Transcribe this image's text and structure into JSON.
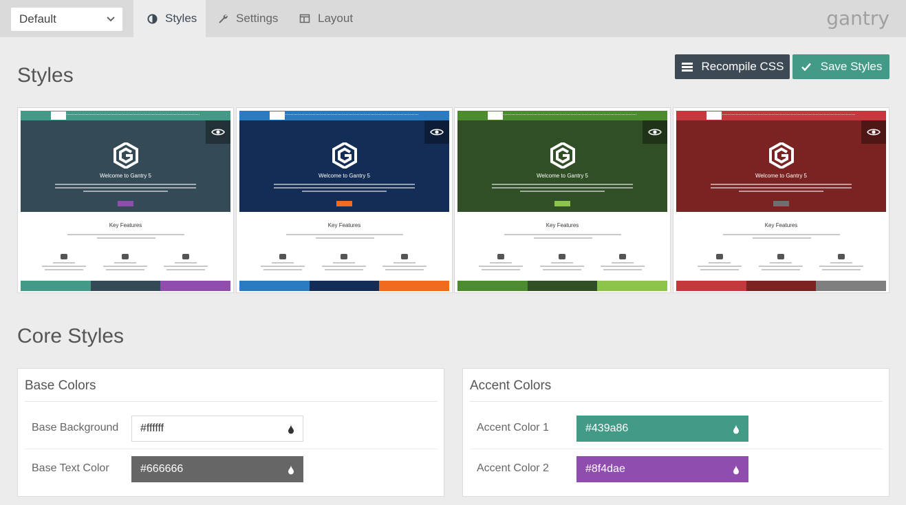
{
  "topbar": {
    "preset_select": "Default",
    "tabs": [
      {
        "label": "Styles",
        "icon": "contrast-icon",
        "active": true
      },
      {
        "label": "Settings",
        "icon": "wrench-icon",
        "active": false
      },
      {
        "label": "Layout",
        "icon": "layout-icon",
        "active": false
      }
    ],
    "logo": "gantry"
  },
  "styles_section": {
    "title": "Styles",
    "recompile_label": "Recompile CSS",
    "save_label": "Save Styles"
  },
  "presets": [
    {
      "nav_color": "#439a86",
      "hero_color": "#354a57",
      "button_color": "#8f4dae",
      "swatches": [
        "#439a86",
        "#354a57",
        "#8f4dae"
      ]
    },
    {
      "nav_color": "#2a7bc0",
      "hero_color": "#142d57",
      "button_color": "#f16a1d",
      "swatches": [
        "#2a7bc0",
        "#142d57",
        "#f16a1d"
      ]
    },
    {
      "nav_color": "#4d8b31",
      "hero_color": "#304f27",
      "button_color": "#8cc34b",
      "swatches": [
        "#4d8b31",
        "#304f27",
        "#8cc34b"
      ]
    },
    {
      "nav_color": "#c4383e",
      "hero_color": "#7a2322",
      "button_color": "#6f6f6f",
      "swatches": [
        "#c4383e",
        "#7a2322",
        "#7f7f7f"
      ]
    }
  ],
  "preset_preview": {
    "hero_title": "Welcome to Gantry 5",
    "features_title": "Key Features"
  },
  "core_styles": {
    "title": "Core Styles",
    "base_colors": {
      "title": "Base Colors",
      "fields": [
        {
          "label": "Base Background",
          "value": "#ffffff",
          "text_color": "#333333"
        },
        {
          "label": "Base Text Color",
          "value": "#666666",
          "text_color": "#ffffff"
        }
      ]
    },
    "accent_colors": {
      "title": "Accent Colors",
      "fields": [
        {
          "label": "Accent Color 1",
          "value": "#439a86",
          "text_color": "#ffffff"
        },
        {
          "label": "Accent Color 2",
          "value": "#8f4dae",
          "text_color": "#ffffff"
        }
      ]
    }
  }
}
